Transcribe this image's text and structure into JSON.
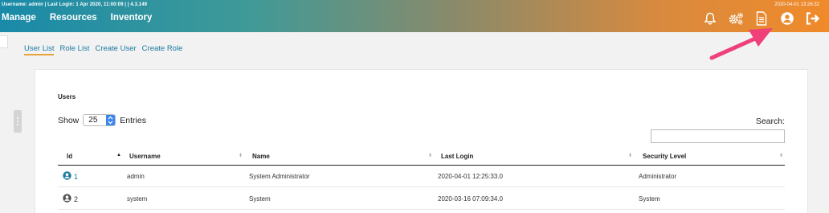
{
  "header": {
    "session_info": "Username: admin | Last Login: 1 Apr 2020, 11:00:09 |   |   4.3.149",
    "datetime": "2020-04-01 13:26:32",
    "nav": [
      {
        "label": "Manage"
      },
      {
        "label": "Resources"
      },
      {
        "label": "Inventory"
      }
    ],
    "icons": [
      "bell-icon",
      "gears-icon",
      "document-icon",
      "user-profile-icon",
      "logout-icon"
    ],
    "gradient_start": "#1a8aa8",
    "gradient_end": "#f08a2a"
  },
  "subtabs": [
    {
      "label": "User List",
      "active": true
    },
    {
      "label": "Role List"
    },
    {
      "label": "Create User"
    },
    {
      "label": "Create Role"
    }
  ],
  "users_panel": {
    "title": "Users",
    "show_label": "Show",
    "entries_value": "25",
    "entries_label": "Entries",
    "search_label": "Search:",
    "search_value": ""
  },
  "table": {
    "columns": [
      "Id",
      "Username",
      "Name",
      "Last Login",
      "Security Level"
    ],
    "rows": [
      {
        "id": "1",
        "username": "admin",
        "name": "System Administrator",
        "last_login": "2020-04-01 12:25:33.0",
        "security_level": "Administrator",
        "id_color": "#1a7aa0"
      },
      {
        "id": "2",
        "username": "system",
        "name": "System",
        "last_login": "2020-03-16 07:09:34.0",
        "security_level": "System",
        "id_color": "#555555"
      }
    ]
  },
  "annotation": {
    "color": "#f0407a"
  }
}
